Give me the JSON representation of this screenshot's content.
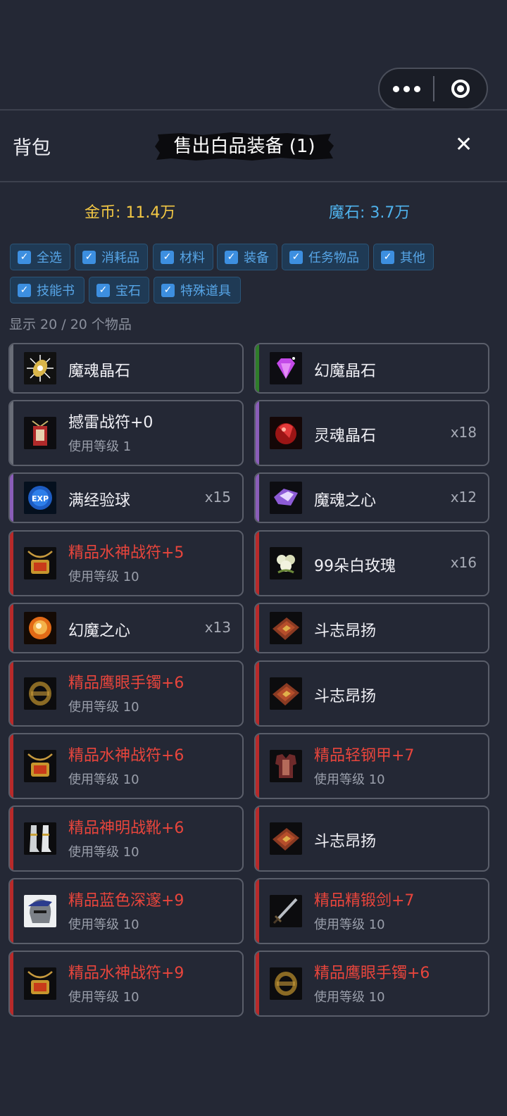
{
  "header": {
    "title": "背包",
    "sell_button": "售出白品装备 (1)"
  },
  "currency": {
    "gold": "金币: 11.4万",
    "stone": "魔石: 3.7万"
  },
  "filters": [
    {
      "label": "全选",
      "checked": true
    },
    {
      "label": "消耗品",
      "checked": true
    },
    {
      "label": "材料",
      "checked": true
    },
    {
      "label": "装备",
      "checked": true
    },
    {
      "label": "任务物品",
      "checked": true
    },
    {
      "label": "其他",
      "checked": true
    },
    {
      "label": "技能书",
      "checked": true
    },
    {
      "label": "宝石",
      "checked": true
    },
    {
      "label": "特殊道具",
      "checked": true
    }
  ],
  "count_text": "显示 20 / 20 个物品",
  "colors": {
    "grey": "#6a6e78",
    "green": "#2f7d2a",
    "purple": "#8a5db8",
    "red": "#b82a2a",
    "gold": "#f2c744",
    "blue": "#4fb2ec",
    "red_text": "#e8453c"
  },
  "items": [
    {
      "name": "魔魂晶石",
      "level": "",
      "qty": "",
      "quality": "grey",
      "icon": "soul-crystal-icon"
    },
    {
      "name": "幻魔晶石",
      "level": "",
      "qty": "",
      "quality": "green",
      "icon": "purple-gem-icon"
    },
    {
      "name": "撼雷战符+0",
      "level": "使用等级 1",
      "qty": "",
      "quality": "grey",
      "icon": "war-talisman-icon"
    },
    {
      "name": "灵魂晶石",
      "level": "",
      "qty": "x18",
      "quality": "purple",
      "icon": "red-crystal-icon"
    },
    {
      "name": "满经验球",
      "level": "",
      "qty": "x15",
      "quality": "purple",
      "icon": "exp-orb-icon"
    },
    {
      "name": "魔魂之心",
      "level": "",
      "qty": "x12",
      "quality": "purple",
      "icon": "purple-crystal-icon"
    },
    {
      "name": "精品水神战符+5",
      "level": "使用等级 10",
      "qty": "",
      "quality": "red",
      "icon": "amulet-icon"
    },
    {
      "name": "99朵白玫瑰",
      "level": "",
      "qty": "x16",
      "quality": "red",
      "icon": "white-rose-icon"
    },
    {
      "name": "幻魔之心",
      "level": "",
      "qty": "x13",
      "quality": "red",
      "icon": "fire-orb-icon"
    },
    {
      "name": "斗志昂扬",
      "level": "",
      "qty": "",
      "quality": "red",
      "icon": "skill-book-icon"
    },
    {
      "name": "精品鹰眼手镯+6",
      "level": "使用等级 10",
      "qty": "",
      "quality": "red",
      "icon": "bracelet-icon"
    },
    {
      "name": "斗志昂扬",
      "level": "",
      "qty": "",
      "quality": "red",
      "icon": "skill-book-icon"
    },
    {
      "name": "精品水神战符+6",
      "level": "使用等级 10",
      "qty": "",
      "quality": "red",
      "icon": "amulet-icon"
    },
    {
      "name": "精品轻钢甲+7",
      "level": "使用等级 10",
      "qty": "",
      "quality": "red",
      "icon": "armor-icon"
    },
    {
      "name": "精品神明战靴+6",
      "level": "使用等级 10",
      "qty": "",
      "quality": "red",
      "icon": "boots-icon"
    },
    {
      "name": "斗志昂扬",
      "level": "",
      "qty": "",
      "quality": "red",
      "icon": "skill-book-icon"
    },
    {
      "name": "精品蓝色深邃+9",
      "level": "使用等级 10",
      "qty": "",
      "quality": "red",
      "icon": "helmet-icon"
    },
    {
      "name": "精品精锻剑+7",
      "level": "使用等级 10",
      "qty": "",
      "quality": "red",
      "icon": "sword-icon"
    },
    {
      "name": "精品水神战符+9",
      "level": "使用等级 10",
      "qty": "",
      "quality": "red",
      "icon": "amulet-icon"
    },
    {
      "name": "精品鹰眼手镯+6",
      "level": "使用等级 10",
      "qty": "",
      "quality": "red",
      "icon": "bracelet-icon"
    }
  ]
}
